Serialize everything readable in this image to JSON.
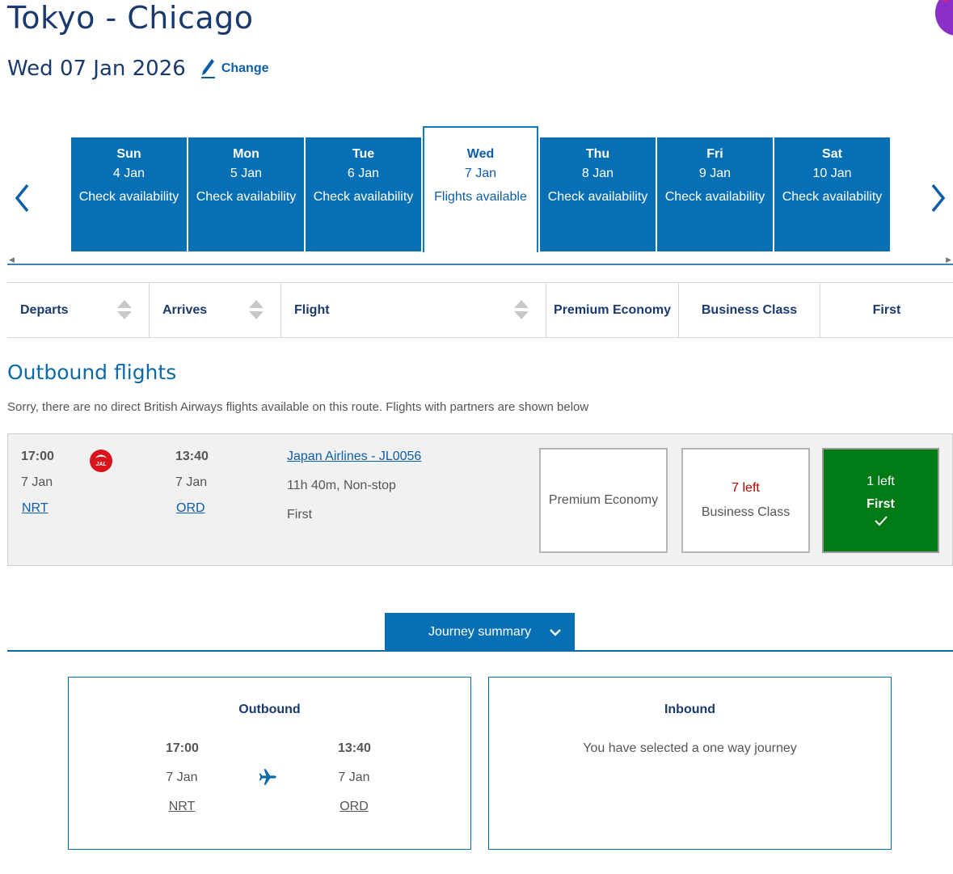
{
  "header": {
    "route_title": "Tokyo - Chicago",
    "date": "Wed 07 Jan 2026",
    "change_label": "Change"
  },
  "days": [
    {
      "name": "Sun",
      "date": "4 Jan",
      "status": "Check availability"
    },
    {
      "name": "Mon",
      "date": "5 Jan",
      "status": "Check availability"
    },
    {
      "name": "Tue",
      "date": "6 Jan",
      "status": "Check availability"
    },
    {
      "name": "Wed",
      "date": "7 Jan",
      "status": "Flights available"
    },
    {
      "name": "Thu",
      "date": "8 Jan",
      "status": "Check availability"
    },
    {
      "name": "Fri",
      "date": "9 Jan",
      "status": "Check availability"
    },
    {
      "name": "Sat",
      "date": "10 Jan",
      "status": "Check availability"
    }
  ],
  "columns": {
    "departs": "Departs",
    "arrives": "Arrives",
    "flight": "Flight",
    "premium_economy": "Premium Economy",
    "business": "Business Class",
    "first": "First"
  },
  "outbound": {
    "title": "Outbound flights",
    "notice": "Sorry, there are no direct British Airways flights available on this route. Flights with partners are shown below"
  },
  "flight": {
    "depart_time": "17:00",
    "depart_date": "7 Jan",
    "depart_airport": "NRT",
    "arrive_time": "13:40",
    "arrive_date": "7 Jan",
    "arrive_airport": "ORD",
    "airline_link": "Japan Airlines - JL0056",
    "duration": "11h 40m, Non-stop",
    "cabin": "First",
    "logo_text": "JAL"
  },
  "cabins": {
    "premium_economy": {
      "label": "Premium Economy"
    },
    "business": {
      "seats_left": "7 left",
      "label": "Business Class"
    },
    "first": {
      "seats_left": "1 left",
      "label": "First"
    }
  },
  "journey_summary": {
    "button_label": "Journey summary",
    "outbound_title": "Outbound",
    "depart_time": "17:00",
    "depart_date": "7 Jan",
    "depart_airport": "NRT",
    "arrive_time": "13:40",
    "arrive_date": "7 Jan",
    "arrive_airport": "ORD",
    "inbound_title": "Inbound",
    "inbound_text": "You have selected a one way journey"
  },
  "colors": {
    "brand_blue": "#0770b4",
    "navy": "#1a3a6e",
    "selected_green": "#007a14",
    "seats_red": "#b30000"
  }
}
